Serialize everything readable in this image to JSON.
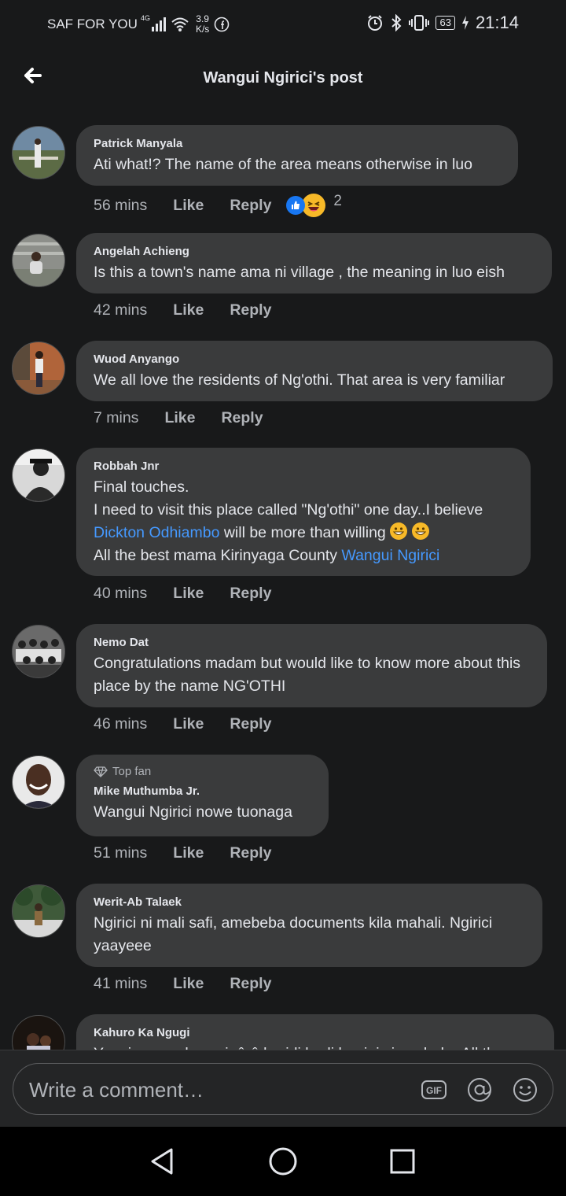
{
  "status_bar": {
    "carrier": "SAF FOR YOU",
    "network": "4G",
    "speed_value": "3.9",
    "speed_unit": "K/s",
    "battery": "63",
    "time": "21:14"
  },
  "header": {
    "title": "Wangui Ngirici's post"
  },
  "actions": {
    "like": "Like",
    "reply": "Reply"
  },
  "comments": [
    {
      "author": "Patrick Manyala",
      "text": "Ati what!? The name of the area means otherwise in luo",
      "time": "56 mins",
      "reaction_count": "2"
    },
    {
      "author": "Angelah Achieng",
      "text": "Is this a town's name ama ni village , the meaning in luo eish",
      "time": "42 mins"
    },
    {
      "author": "Wuod Anyango",
      "text": "We all love the residents of Ng'othi. That area is very familiar",
      "time": "7 mins"
    },
    {
      "author": "Robbah Jnr",
      "line1": "Final touches.",
      "line2": "I need to visit this place called \"Ng'othi\" one day..I believe",
      "mention1": "Dickton Odhiambo",
      "line3_rest": " will be more than willing",
      "line4_start": "All the best mama Kirinyaga County ",
      "mention2": "Wangui Ngirici",
      "time": "40 mins"
    },
    {
      "author": "Nemo Dat",
      "text": "Congratulations madam but would like to know more about this place by the name NG'OTHI",
      "time": "46 mins"
    },
    {
      "badge": "Top fan",
      "author": "Mike Muthumba Jr.",
      "text": "Wangui Ngirici nowe tuonaga",
      "time": "51 mins"
    },
    {
      "author": "Werit-Ab Talaek",
      "text": "Ngirici ni mali safi, amebeba documents kila mahali. Ngirici yaayeee",
      "time": "41 mins"
    },
    {
      "author": "Kahuro Ka Ngugi",
      "text": "Yeeni umewaka waigûrû baridi badi banigi siasa baba All the"
    }
  ],
  "composer": {
    "placeholder": "Write a comment…",
    "gif_label": "GIF"
  }
}
